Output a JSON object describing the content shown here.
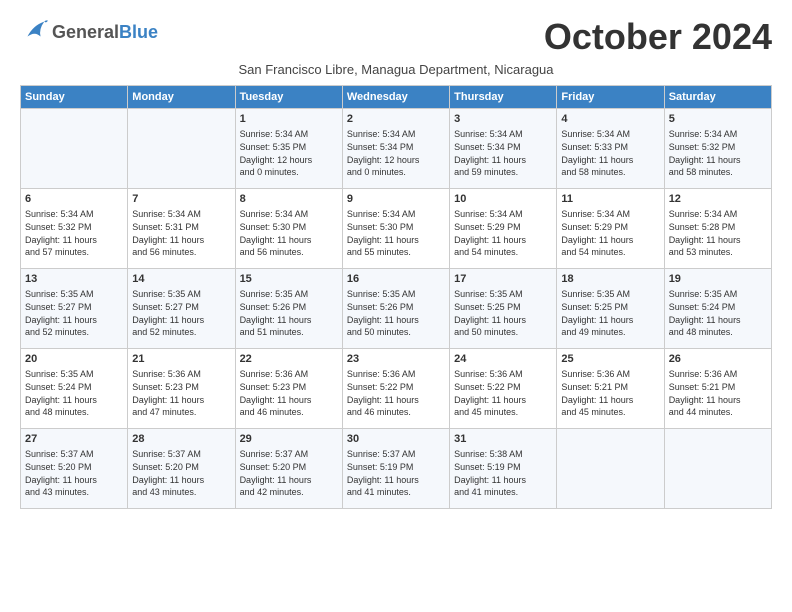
{
  "header": {
    "logo_general": "General",
    "logo_blue": "Blue",
    "month_title": "October 2024",
    "subtitle": "San Francisco Libre, Managua Department, Nicaragua"
  },
  "weekdays": [
    "Sunday",
    "Monday",
    "Tuesday",
    "Wednesday",
    "Thursday",
    "Friday",
    "Saturday"
  ],
  "weeks": [
    [
      {
        "day": "",
        "info": ""
      },
      {
        "day": "",
        "info": ""
      },
      {
        "day": "1",
        "info": "Sunrise: 5:34 AM\nSunset: 5:35 PM\nDaylight: 12 hours\nand 0 minutes."
      },
      {
        "day": "2",
        "info": "Sunrise: 5:34 AM\nSunset: 5:34 PM\nDaylight: 12 hours\nand 0 minutes."
      },
      {
        "day": "3",
        "info": "Sunrise: 5:34 AM\nSunset: 5:34 PM\nDaylight: 11 hours\nand 59 minutes."
      },
      {
        "day": "4",
        "info": "Sunrise: 5:34 AM\nSunset: 5:33 PM\nDaylight: 11 hours\nand 58 minutes."
      },
      {
        "day": "5",
        "info": "Sunrise: 5:34 AM\nSunset: 5:32 PM\nDaylight: 11 hours\nand 58 minutes."
      }
    ],
    [
      {
        "day": "6",
        "info": "Sunrise: 5:34 AM\nSunset: 5:32 PM\nDaylight: 11 hours\nand 57 minutes."
      },
      {
        "day": "7",
        "info": "Sunrise: 5:34 AM\nSunset: 5:31 PM\nDaylight: 11 hours\nand 56 minutes."
      },
      {
        "day": "8",
        "info": "Sunrise: 5:34 AM\nSunset: 5:30 PM\nDaylight: 11 hours\nand 56 minutes."
      },
      {
        "day": "9",
        "info": "Sunrise: 5:34 AM\nSunset: 5:30 PM\nDaylight: 11 hours\nand 55 minutes."
      },
      {
        "day": "10",
        "info": "Sunrise: 5:34 AM\nSunset: 5:29 PM\nDaylight: 11 hours\nand 54 minutes."
      },
      {
        "day": "11",
        "info": "Sunrise: 5:34 AM\nSunset: 5:29 PM\nDaylight: 11 hours\nand 54 minutes."
      },
      {
        "day": "12",
        "info": "Sunrise: 5:34 AM\nSunset: 5:28 PM\nDaylight: 11 hours\nand 53 minutes."
      }
    ],
    [
      {
        "day": "13",
        "info": "Sunrise: 5:35 AM\nSunset: 5:27 PM\nDaylight: 11 hours\nand 52 minutes."
      },
      {
        "day": "14",
        "info": "Sunrise: 5:35 AM\nSunset: 5:27 PM\nDaylight: 11 hours\nand 52 minutes."
      },
      {
        "day": "15",
        "info": "Sunrise: 5:35 AM\nSunset: 5:26 PM\nDaylight: 11 hours\nand 51 minutes."
      },
      {
        "day": "16",
        "info": "Sunrise: 5:35 AM\nSunset: 5:26 PM\nDaylight: 11 hours\nand 50 minutes."
      },
      {
        "day": "17",
        "info": "Sunrise: 5:35 AM\nSunset: 5:25 PM\nDaylight: 11 hours\nand 50 minutes."
      },
      {
        "day": "18",
        "info": "Sunrise: 5:35 AM\nSunset: 5:25 PM\nDaylight: 11 hours\nand 49 minutes."
      },
      {
        "day": "19",
        "info": "Sunrise: 5:35 AM\nSunset: 5:24 PM\nDaylight: 11 hours\nand 48 minutes."
      }
    ],
    [
      {
        "day": "20",
        "info": "Sunrise: 5:35 AM\nSunset: 5:24 PM\nDaylight: 11 hours\nand 48 minutes."
      },
      {
        "day": "21",
        "info": "Sunrise: 5:36 AM\nSunset: 5:23 PM\nDaylight: 11 hours\nand 47 minutes."
      },
      {
        "day": "22",
        "info": "Sunrise: 5:36 AM\nSunset: 5:23 PM\nDaylight: 11 hours\nand 46 minutes."
      },
      {
        "day": "23",
        "info": "Sunrise: 5:36 AM\nSunset: 5:22 PM\nDaylight: 11 hours\nand 46 minutes."
      },
      {
        "day": "24",
        "info": "Sunrise: 5:36 AM\nSunset: 5:22 PM\nDaylight: 11 hours\nand 45 minutes."
      },
      {
        "day": "25",
        "info": "Sunrise: 5:36 AM\nSunset: 5:21 PM\nDaylight: 11 hours\nand 45 minutes."
      },
      {
        "day": "26",
        "info": "Sunrise: 5:36 AM\nSunset: 5:21 PM\nDaylight: 11 hours\nand 44 minutes."
      }
    ],
    [
      {
        "day": "27",
        "info": "Sunrise: 5:37 AM\nSunset: 5:20 PM\nDaylight: 11 hours\nand 43 minutes."
      },
      {
        "day": "28",
        "info": "Sunrise: 5:37 AM\nSunset: 5:20 PM\nDaylight: 11 hours\nand 43 minutes."
      },
      {
        "day": "29",
        "info": "Sunrise: 5:37 AM\nSunset: 5:20 PM\nDaylight: 11 hours\nand 42 minutes."
      },
      {
        "day": "30",
        "info": "Sunrise: 5:37 AM\nSunset: 5:19 PM\nDaylight: 11 hours\nand 41 minutes."
      },
      {
        "day": "31",
        "info": "Sunrise: 5:38 AM\nSunset: 5:19 PM\nDaylight: 11 hours\nand 41 minutes."
      },
      {
        "day": "",
        "info": ""
      },
      {
        "day": "",
        "info": ""
      }
    ]
  ]
}
